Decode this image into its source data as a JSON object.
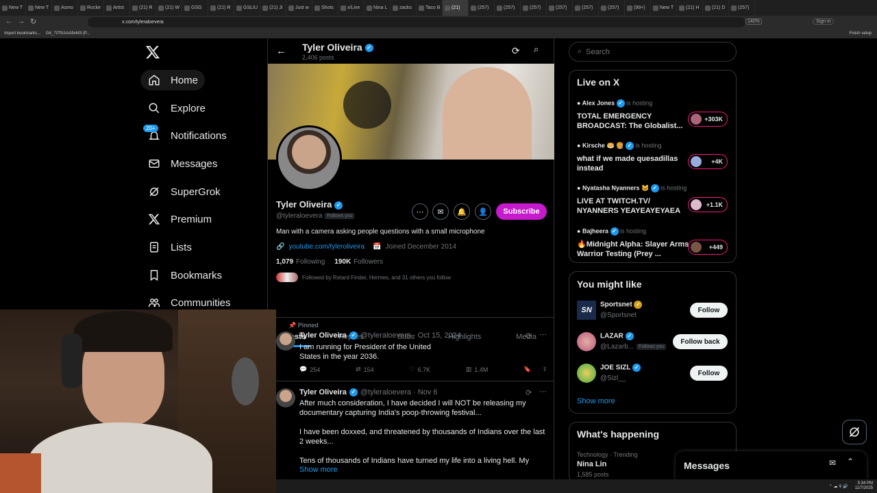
{
  "browser": {
    "tabs": [
      "New T",
      "New T",
      "Asmo",
      "Rocke",
      "Artist",
      "(21) R",
      "(21) W",
      "GSG",
      "(21) R",
      "GSLIU",
      "(21) Ji",
      "Just w",
      "Shots",
      "x/Live",
      "Nina L",
      "zacks",
      "Taco B",
      "(21)",
      "(257)",
      "(257)",
      "(257)",
      "(257)",
      "(257)",
      "(257)",
      "(99+)",
      "New T",
      "(21) H",
      "(21) D",
      "(257)"
    ],
    "url": "x.com/tyleraloevera",
    "zoom": "140%",
    "sign_in": "Sign in",
    "finish_setup": "Finish setup",
    "bookmarks": [
      "Import bookmarks...",
      "G4_7t7fXAAA9vM3 (P..."
    ]
  },
  "nav": {
    "home": "Home",
    "explore": "Explore",
    "notifications": "Notifications",
    "notif_badge": "20+",
    "messages": "Messages",
    "supergrok": "SuperGrok",
    "premium": "Premium",
    "lists": "Lists",
    "bookmarks": "Bookmarks",
    "communities": "Communities"
  },
  "profile": {
    "header_name": "Tyler Oliveira",
    "posts_count": "2,406 posts",
    "name": "Tyler Oliveira",
    "handle": "@tyleraloevera",
    "follows_you": "Follows you",
    "bio": "Man with a camera asking people questions with a small microphone",
    "link": "youtube.com/tyleroliveira",
    "joined": "Joined December 2014",
    "following_count": "1,079",
    "following_label": "Following",
    "followers_count": "190K",
    "followers_label": "Followers",
    "followed_by": "Followed by Retard Finder, Hermes, and 31 others you follow",
    "subscribe": "Subscribe",
    "tabs": [
      "Posts",
      "Replies",
      "Subs",
      "Highlights",
      "Media"
    ]
  },
  "posts": [
    {
      "pinned": "Pinned",
      "name": "Tyler Oliveira",
      "meta": "@tyleraloevera · Oct 15, 2024",
      "text": "I am running for President of the United States in the year 2036.",
      "replies": "254",
      "reposts": "154",
      "likes": "6.7K",
      "views": "1.4M"
    },
    {
      "name": "Tyler Oliveira",
      "meta": "@tyleraloevera · Nov 6",
      "text1": "After much consideration, I have decided I will NOT be releasing my documentary capturing India's poop-throwing festival...",
      "text2": "I have been doxxed, and threatened by thousands of Indians over the last 2 weeks...",
      "text3": "Tens of thousands of Indians have turned my life into a living hell. My",
      "show_more": "Show more"
    }
  ],
  "search": {
    "placeholder": "Search"
  },
  "live": {
    "title": "Live on X",
    "hosting": "is hosting",
    "items": [
      {
        "host": "Alex Jones",
        "title": "TOTAL EMERGENCY BROADCAST: The Globalist...",
        "count": "+303K"
      },
      {
        "host": "Kirsche 🥯 🍔",
        "title": "what if we made quesadillas instead",
        "count": "+4K"
      },
      {
        "host": "Nyatasha Nyanners 🐱",
        "title": "LIVE AT TWITCH.TV/ NYANNERS YEAYEAYEYAEA",
        "count": "+1.1K"
      },
      {
        "host": "Bajheera",
        "title": "🔥Midnight Alpha: Slayer Arms Warrior Testing (Prey ...",
        "count": "+449"
      }
    ]
  },
  "might_like": {
    "title": "You might like",
    "items": [
      {
        "name": "Sportsnet",
        "handle": "@Sportsnet",
        "button": "Follow",
        "logo": "SN"
      },
      {
        "name": "LAZAR",
        "handle": "@Lazarb...",
        "follows_you": "Follows you",
        "button": "Follow back"
      },
      {
        "name": "JOE SIZL",
        "handle": "@Sizl__",
        "button": "Follow"
      }
    ],
    "show_more": "Show more"
  },
  "happening": {
    "title": "What's happening",
    "category": "Technology · Trending",
    "topic": "Nina Lin",
    "posts": "1,585 posts"
  },
  "messages_dock": {
    "title": "Messages"
  },
  "taskbar": {
    "time": "5:34 PM",
    "date": "11/7/2025"
  }
}
